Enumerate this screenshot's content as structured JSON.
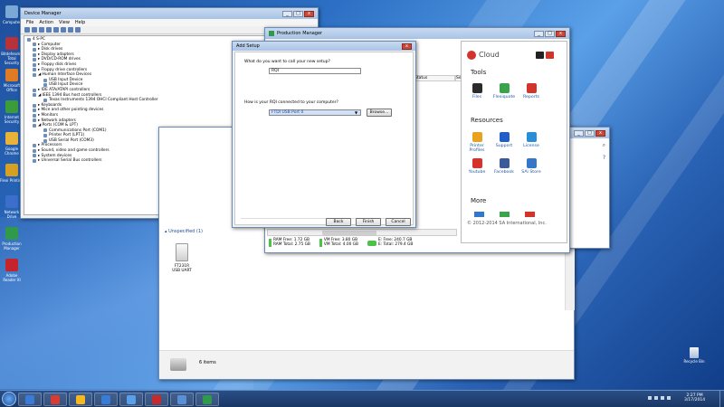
{
  "desktop": {
    "icons": [
      {
        "label": "Computer",
        "color": "#7aa9d8"
      },
      {
        "label": "Bitdefender Total Security",
        "color": "#b8323b"
      },
      {
        "label": "Microsoft Office",
        "color": "#e07b25"
      },
      {
        "label": "Internet Security",
        "color": "#3c9c3a"
      },
      {
        "label": "Google Chrome",
        "color": "#e9b33a"
      },
      {
        "label": "Flexi Printing",
        "color": "#d6a022"
      },
      {
        "label": "Network Drive",
        "color": "#3b6fcb"
      },
      {
        "label": "Production Manager",
        "color": "#2f9a4a"
      },
      {
        "label": "Adobe Reader XI",
        "color": "#c4242c"
      }
    ],
    "recycle_bin": "Recycle Bin"
  },
  "device_manager": {
    "title": "Device Manager",
    "menu": [
      "File",
      "Action",
      "View",
      "Help"
    ],
    "tree": [
      "4  S-PC",
      "▸ Computer",
      "▸ Disk drives",
      "▸ Display adapters",
      "▸ DVD/CD-ROM drives",
      "▸ Floppy disk drives",
      "▸ Floppy drive controllers",
      "◢ Human Interface Devices",
      "   USB Input Device",
      "   USB Input Device",
      "▸ IDE ATA/ATAPI controllers",
      "◢ IEEE 1394 Bus host controllers",
      "   Texas Instruments 1394 OHCI Compliant Host Controller",
      "▸ Keyboards",
      "▸ Mice and other pointing devices",
      "▸ Monitors",
      "▸ Network adapters",
      "◢ Ports (COM & LPT)",
      "   Communications Port (COM1)",
      "   Printer Port (LPT1)",
      "   USB Serial Port (COM3)",
      "▸ Processors",
      "▸ Sound, video and game controllers",
      "▸ System devices",
      "▸ Universal Serial Bus controllers"
    ]
  },
  "production_manager": {
    "title": "Production Manager",
    "col_status": "Status",
    "col_se": "Se",
    "status": {
      "ram_free": "RAM Free: 1.72 GB",
      "ram_total": "RAM Total: 2.75 GB",
      "vm_free": "VM Free: 3.80 GB",
      "vm_total": "VM Total: 4.00 GB",
      "e_free": "E: Free: 240.7 GB",
      "e_total": "E: Total: 279.4 GB"
    }
  },
  "add_setup": {
    "title": "Add Setup",
    "q_name": "What do you want to call your new setup?",
    "name_value": "RQI",
    "q_connect": "How is your RQI connected to your computer?",
    "connect_value": "FTDI USB Port 0",
    "browse": "Browse...",
    "back": "Back",
    "finish": "Finish",
    "cancel": "Cancel"
  },
  "cloud_panel": {
    "title": "Cloud",
    "tools_h": "Tools",
    "tools": [
      {
        "label": "Files",
        "color": "#2b2b2b"
      },
      {
        "label": "Flexiquote",
        "color": "#3aa44a"
      },
      {
        "label": "Reports",
        "color": "#d2332b"
      }
    ],
    "resources_h": "Resources",
    "resources": [
      {
        "label": "Printer Profiles",
        "color": "#e9a21f"
      },
      {
        "label": "Support",
        "color": "#1f5ec8"
      },
      {
        "label": "License",
        "color": "#2a8dd8"
      },
      {
        "label": "Youtube",
        "color": "#d5332b"
      },
      {
        "label": "Facebook",
        "color": "#3b5a9a"
      },
      {
        "label": "SAi Store",
        "color": "#3477c8"
      }
    ],
    "more_h": "More",
    "copyright": "© 2012-2014 SA International, Inc."
  },
  "explorer": {
    "group": "▴ Unspecified (1)",
    "device_label": "FT231R USB UART",
    "items_count": "6 items"
  },
  "taskbar": {
    "time": "2:27 PM",
    "date": "3/17/2014",
    "apps": [
      "#3a7bd5",
      "#d83b30",
      "#f7b71f",
      "#3a7bd5",
      "#5aa0e8",
      "#c62a2a",
      "#5a8fd8",
      "#2f9a4a"
    ]
  }
}
